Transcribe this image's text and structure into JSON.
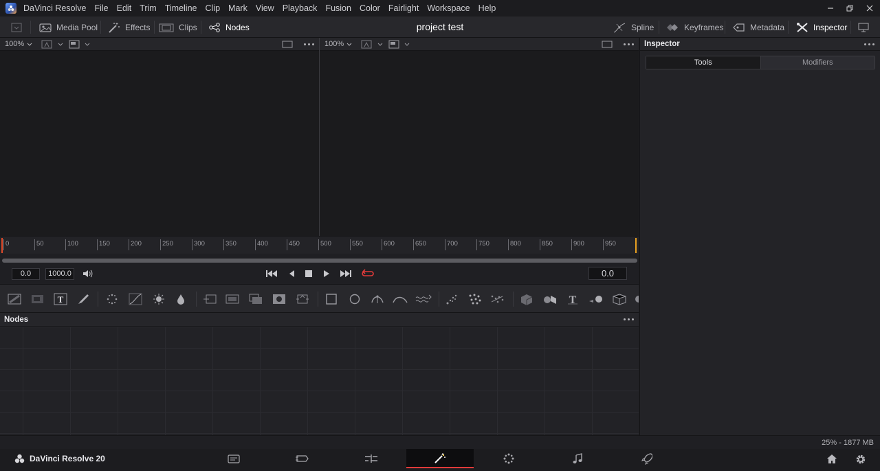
{
  "app": {
    "name": "DaVinci Resolve",
    "brand": "DaVinci Resolve 20",
    "logo_icon": "davinci-logo-icon"
  },
  "menus": [
    "File",
    "Edit",
    "Trim",
    "Timeline",
    "Clip",
    "Mark",
    "View",
    "Playback",
    "Fusion",
    "Color",
    "Fairlight",
    "Workspace",
    "Help"
  ],
  "toolbar": {
    "media_pool": "Media Pool",
    "effects": "Effects",
    "clips": "Clips",
    "nodes": "Nodes",
    "project_title": "project test",
    "spline": "Spline",
    "keyframes": "Keyframes",
    "metadata": "Metadata",
    "inspector": "Inspector"
  },
  "viewers": [
    {
      "zoom": "100%"
    },
    {
      "zoom": "100%"
    }
  ],
  "ruler": {
    "ticks": [
      "0",
      "50",
      "100",
      "150",
      "200",
      "250",
      "300",
      "350",
      "400",
      "450",
      "500",
      "550",
      "600",
      "650",
      "700",
      "750",
      "800",
      "850",
      "900",
      "950"
    ]
  },
  "transport": {
    "render_start": "0.0",
    "render_end": "1000.0",
    "current_time": "0.0"
  },
  "nodes": {
    "title": "Nodes"
  },
  "inspector": {
    "title": "Inspector",
    "tabs": [
      "Tools",
      "Modifiers"
    ],
    "active_tab": "Tools"
  },
  "status": {
    "memory": "25% - 1877 MB"
  },
  "pages": {
    "active": "fusion",
    "items": [
      "media",
      "cut",
      "edit",
      "fusion",
      "color",
      "fairlight",
      "deliver"
    ]
  },
  "colors": {
    "accent_red": "#e03a3a",
    "playhead_orange": "#e8a020",
    "bg": "#1f1f23"
  }
}
